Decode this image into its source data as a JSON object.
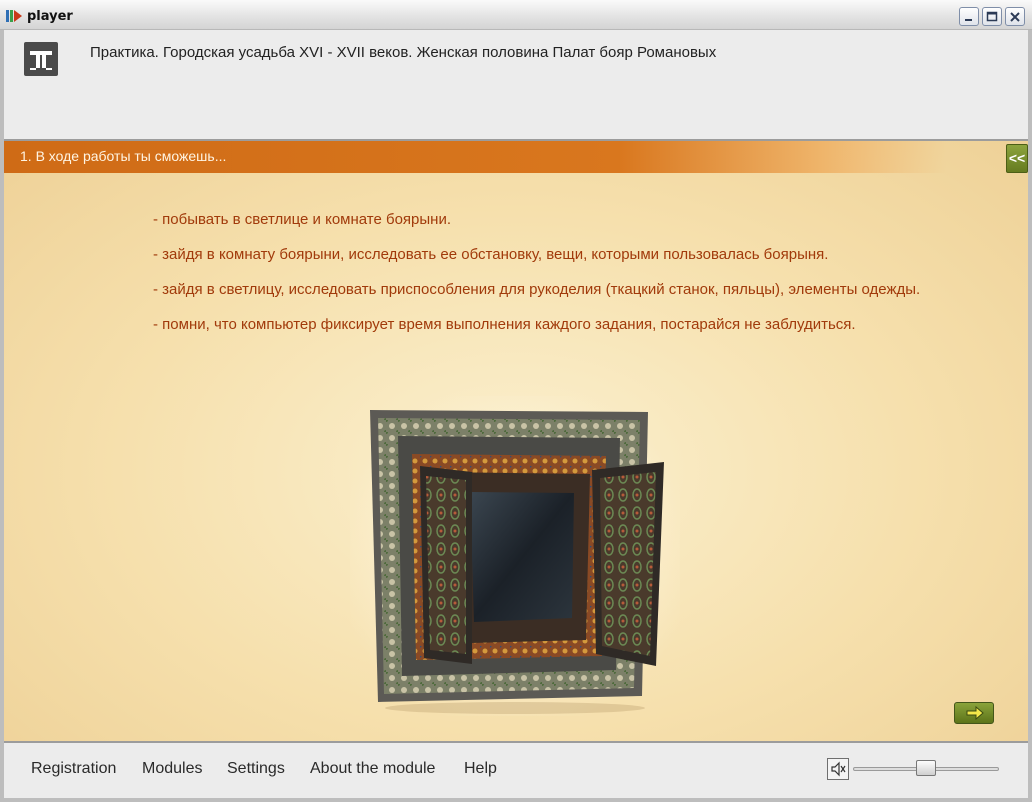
{
  "window": {
    "title": "player"
  },
  "header": {
    "logo_icon": "module-logo-icon",
    "title": "Практика. Городская усадьба XVI - XVII веков. Женская половина Палат бояр Романовых"
  },
  "section": {
    "title": "1. В ходе работы ты сможешь...",
    "collapse_label": "<<"
  },
  "bullets": [
    "- побывать в светлице и комнате боярыни.",
    "- зайдя в комнату боярыни, исследовать ее обстановку, вещи, которыми пользовалась боярыня.",
    "- зайдя в светлицу, исследовать приспособления для рукоделия (ткацкий станок, пяльцы), элементы одежды.",
    "- помни, что компьютер фиксирует время выполнения каждого задания, постарайся не заблудиться."
  ],
  "artwork": {
    "icon": "ornate-mirror-image"
  },
  "next_button": {
    "icon": "arrow-right-icon"
  },
  "bottom_nav": {
    "items": [
      "Registration",
      "Modules",
      "Settings",
      "About the module",
      "Help"
    ]
  },
  "volume": {
    "icon": "speaker-muted-icon",
    "level": 0.5
  },
  "colors": {
    "accent_orange": "#d9771e",
    "text_red": "#a13a0b",
    "button_green": "#7a9430"
  }
}
